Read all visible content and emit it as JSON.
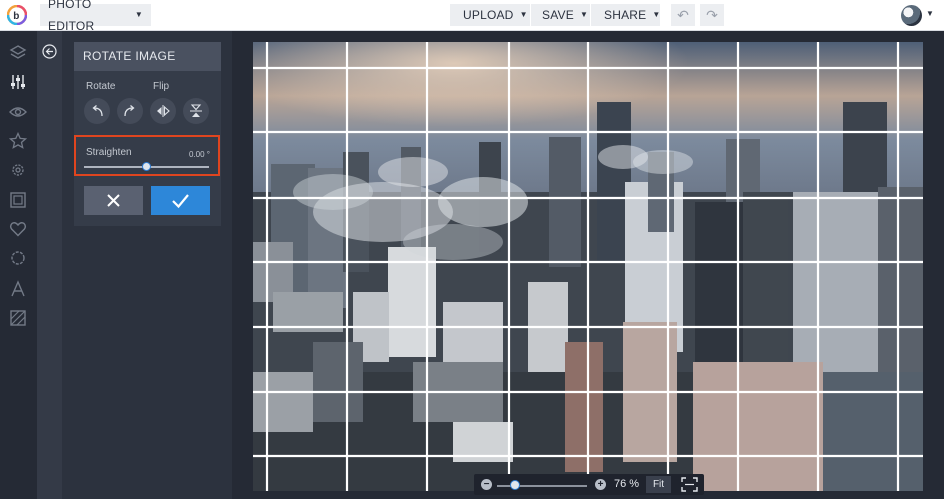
{
  "topbar": {
    "app_menu_label": "PHOTO EDITOR",
    "upload_label": "UPLOAD",
    "save_label": "SAVE",
    "share_label": "SHARE"
  },
  "panel": {
    "title": "ROTATE IMAGE",
    "rotate_label": "Rotate",
    "flip_label": "Flip",
    "straighten_label": "Straighten",
    "straighten_value": "0.00 °",
    "straighten_level": 0.5
  },
  "sidebar": {
    "icons": [
      "layers-icon",
      "adjust-icon",
      "eye-icon",
      "star-icon",
      "gear-icon",
      "frame-icon",
      "heart-icon",
      "badge-icon",
      "text-icon",
      "texture-icon"
    ]
  },
  "zoom": {
    "value": "76 %",
    "fit_label": "Fit",
    "level": 0.2
  },
  "colors": {
    "accent": "#2d87d9",
    "highlight": "#e0451f",
    "panel_bg": "#2c323e"
  }
}
